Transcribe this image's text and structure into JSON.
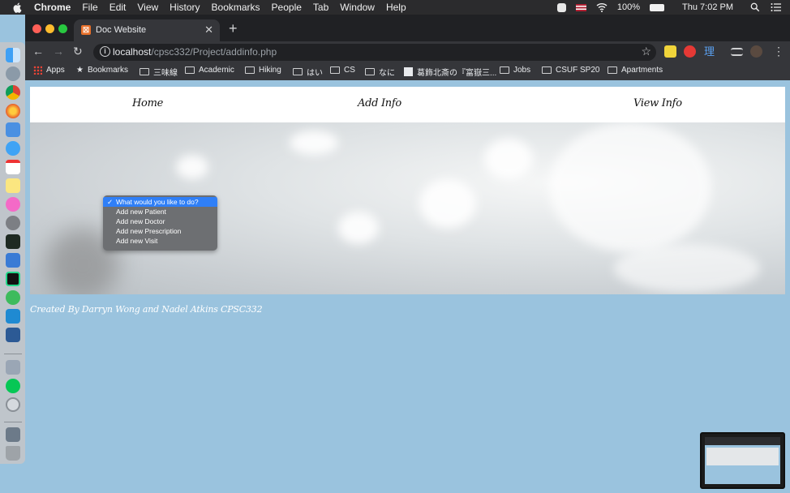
{
  "menubar": {
    "app_name": "Chrome",
    "items": [
      "File",
      "Edit",
      "View",
      "History",
      "Bookmarks",
      "People",
      "Tab",
      "Window",
      "Help"
    ],
    "battery": "100%",
    "clock": "Thu 7:02 PM"
  },
  "browser": {
    "tab_title": "Doc Website",
    "url_host": "localhost",
    "url_path": "/cpsc332/Project/addinfo.php",
    "bookmarks": [
      "Apps",
      "Bookmarks",
      "三味線",
      "Academic",
      "Hiking",
      "はい",
      "CS",
      "なに",
      "葛飾北斎の『富嶽三...",
      "Jobs",
      "CSUF SP20",
      "Apartments"
    ]
  },
  "page": {
    "nav": {
      "home": "Home",
      "add_info": "Add Info",
      "view_info": "View Info"
    },
    "dropdown": {
      "selected": "What would you like to do?",
      "options": [
        "What would you like to do?",
        "Add new Patient",
        "Add new Doctor",
        "Add new Prescription",
        "Add new Visit"
      ]
    },
    "footer": "Created By Darryn Wong and Nadel Atkins CPSC332"
  },
  "colors": {
    "page_bg": "#9ac3de",
    "dropdown_highlight": "#2f7ff7",
    "tab_favicon": "#e8702a"
  }
}
